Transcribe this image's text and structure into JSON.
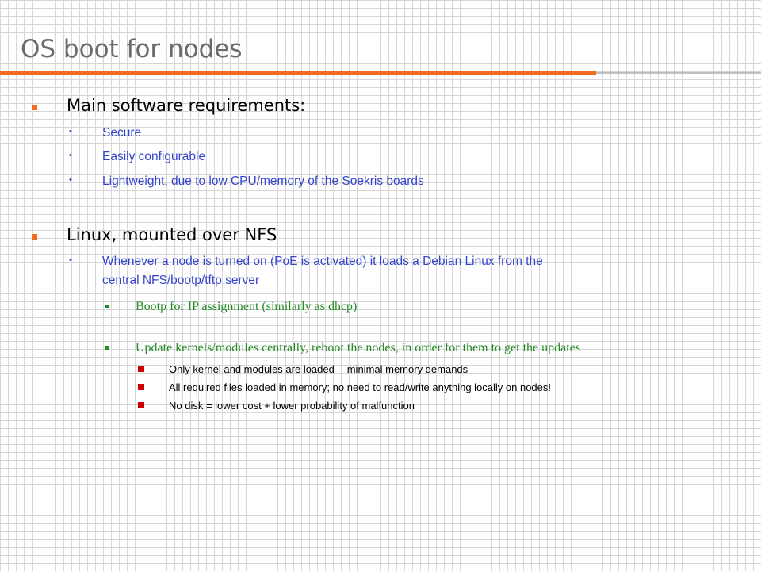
{
  "title": "OS boot for nodes",
  "sections": [
    {
      "heading": "Main software requirements:",
      "items": [
        "Secure",
        "Easily configurable",
        "Lightweight, due to low CPU/memory of the Soekris boards"
      ]
    },
    {
      "heading": "Linux, mounted over NFS",
      "items": [
        {
          "lines": [
            "Whenever a node is turned on (PoE is activated) it loads a Debian Linux from the",
            "central NFS/bootp/tftp server"
          ],
          "subitems": [
            "Bootp for IP assignment (similarly as dhcp)",
            "Update kernels/modules centrally, reboot the nodes, in order for them to get the updates"
          ],
          "details": [
            "Only kernel and modules are loaded -- minimal memory demands",
            "All required files loaded in memory; no need to read/write anything locally on nodes!",
            "No disk = lower cost + lower probability of malfunction"
          ]
        }
      ]
    }
  ],
  "colors": {
    "accent": "#f26b21",
    "title": "#6b6b6b",
    "level2": "#3344cc",
    "level3": "#228b22",
    "level4_bullet": "#cc0000"
  }
}
